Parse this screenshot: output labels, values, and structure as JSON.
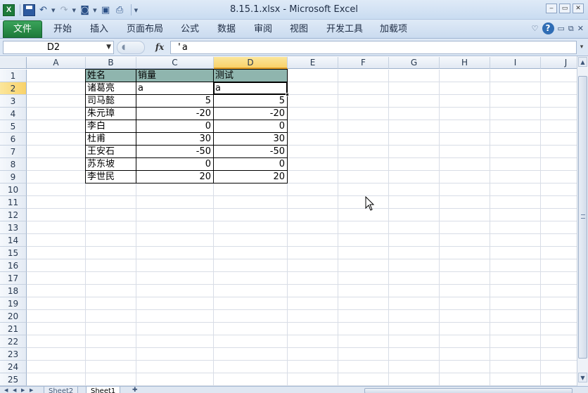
{
  "title": {
    "window_title": "8.15.1.xlsx  -  Microsoft Excel",
    "app_logo": "X"
  },
  "icons": {
    "app": "excel-logo-icon",
    "save": "save-icon",
    "undo": "undo-icon",
    "redo": "redo-icon",
    "camera": "camera-icon",
    "print_preview": "print-preview-icon",
    "customize": "customize-quick-access-icon",
    "help": "help-icon",
    "fx": "insert-function-icon"
  },
  "window_buttons": {
    "minimize": "‒",
    "restore": "▭",
    "close": "✕"
  },
  "ribbon": {
    "file_tab": "文件",
    "tabs": [
      "开始",
      "插入",
      "页面布局",
      "公式",
      "数据",
      "审阅",
      "视图",
      "开发工具",
      "加载项"
    ],
    "help_label": "?"
  },
  "formula_bar": {
    "name_box": "D2",
    "fx_label": "fx",
    "formula": "'a"
  },
  "grid": {
    "columns": [
      "A",
      "B",
      "C",
      "D",
      "E",
      "F",
      "G",
      "H",
      "I",
      "J"
    ],
    "rows": [
      "1",
      "2",
      "3",
      "4",
      "5",
      "6",
      "7",
      "8",
      "9",
      "10",
      "11",
      "12",
      "13",
      "14",
      "15",
      "16",
      "17",
      "18",
      "19",
      "20",
      "21",
      "22",
      "23",
      "24",
      "25"
    ],
    "active_cell": "D2",
    "active_column": "D",
    "active_row": "2",
    "data": [
      {
        "row": "1",
        "B": "姓名",
        "C": "销量",
        "D": "测试"
      },
      {
        "row": "2",
        "B": "诸葛亮",
        "C": "a",
        "D": "a"
      },
      {
        "row": "3",
        "B": "司马懿",
        "C": "5",
        "D": "5"
      },
      {
        "row": "4",
        "B": "朱元璋",
        "C": "-20",
        "D": "-20"
      },
      {
        "row": "5",
        "B": "李白",
        "C": "0",
        "D": "0"
      },
      {
        "row": "6",
        "B": "杜甫",
        "C": "30",
        "D": "30"
      },
      {
        "row": "7",
        "B": "王安石",
        "C": "-50",
        "D": "-50"
      },
      {
        "row": "8",
        "B": "苏东坡",
        "C": "0",
        "D": "0"
      },
      {
        "row": "9",
        "B": "李世民",
        "C": "20",
        "D": "20"
      }
    ],
    "header_fill": "#8fb5ae"
  },
  "sheet_tabs": [
    "Sheet2",
    "Sheet1"
  ],
  "active_sheet": "Sheet1"
}
